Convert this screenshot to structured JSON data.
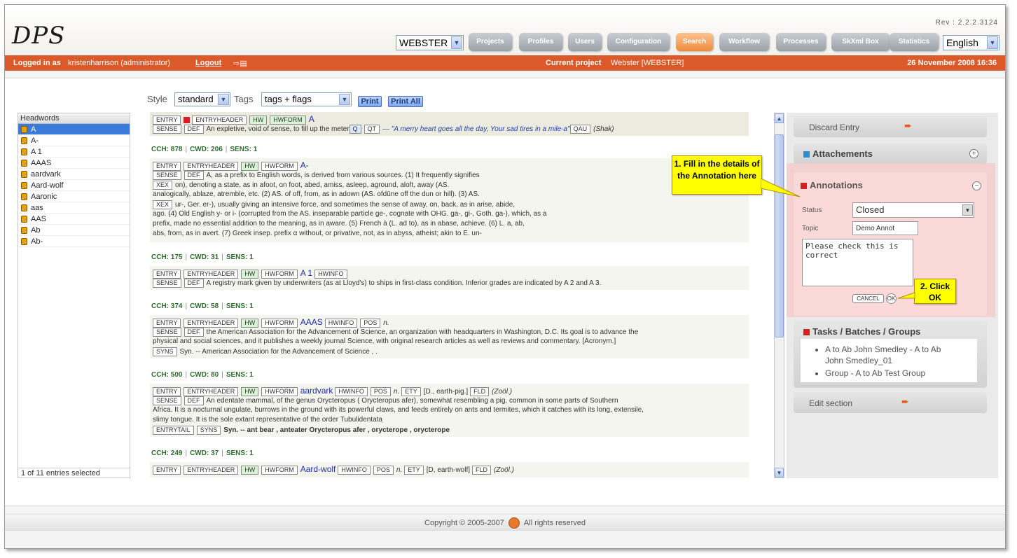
{
  "app": {
    "logo": "DPS",
    "revision": "Rev : 2.2.2.3124"
  },
  "header": {
    "dictionary_select": "WEBSTER",
    "language_select": "English",
    "nav": [
      "Projects",
      "Profiles",
      "Users",
      "Configuration",
      "Search",
      "Workflow",
      "Processes",
      "SkXml Box",
      "Statistics"
    ],
    "active_nav": "Search",
    "logged_in_label": "Logged in as",
    "user": "kristenharrison (administrator)",
    "logout": "Logout",
    "current_project_label": "Current project",
    "current_project": "Webster [WEBSTER]",
    "date": "26 November 2008 16:36"
  },
  "toolbar": {
    "style_label": "Style",
    "style_value": "standard",
    "tags_label": "Tags",
    "tags_value": "tags + flags",
    "print": "Print",
    "print_all": "Print All"
  },
  "headwords": {
    "title": "Headwords",
    "items": [
      "A",
      "A-",
      "A 1",
      "AAAS",
      "aardvark",
      "Aard-wolf",
      "Aaronic",
      "aas",
      "AAS",
      "Ab",
      "Ab-"
    ],
    "footer": "1 of 11 entries selected"
  },
  "entries": {
    "e0": {
      "head": "A",
      "def": "An expletive, void of sense, to fill up the meter",
      "quote": "— \"A merry heart goes all the day, Your sad tires in a mile-a\"",
      "source": "(Shak)"
    },
    "e1": {
      "cch": "CCH: 878",
      "cwd": "CWD: 206",
      "sens": "SENS: 1",
      "head": "A-",
      "l1": "A, as a prefix to English words, is derived from various sources. (1) It frequently signifies",
      "l2": "on), denoting a state, as in  afoot, on foot,  abed,  amiss,  asleep, aground,  aloft,  away (AS.",
      "l3": "analogically,  ablaze,  atremble, etc. (2) AS.  of off, from, as in  adown (AS.  ofdūne off the  dun or hill). (3) AS.",
      "l4": "ur-, Ger.  er-), usually giving an intensive force, and sometimes the sense of  away,  on,  back, as in  arise,  abide,",
      "l5": "ago. (4) Old English  y- or  i- (corrupted from the AS. inseparable particle  ge-, cognate with OHG.  ga-,  gi-, Goth.  ga-), which, as a",
      "l6": "prefix, made no essential addition to the meaning, as in aware. (5) French  à (L.  ad to), as in  abase,  achieve. (6) L.  a,  ab,",
      "l7": "abs, from, as in  avert. (7) Greek insep. prefix α without, or privative, not, as in  abyss,  atheist; akin to E.  un-"
    },
    "e2": {
      "cch": "CCH: 175",
      "cwd": "CWD: 31",
      "sens": "SENS: 1",
      "head": "A 1",
      "def": "A registry mark given by underwriters (as at Lloyd's) to ships in first-class condition. Inferior grades are indicated by A 2 and A 3."
    },
    "e3": {
      "cch": "CCH: 374",
      "cwd": "CWD: 58",
      "sens": "SENS: 1",
      "head": "AAAS",
      "pos": "n.",
      "l1": "the  American Association for the Advancement of Science, an organization with headquarters in Washington, D.C. Its goal is to advance the",
      "l2": "physical and social sciences, and it publishes a weekly journal  Science, with original research articles as well as reviews and commentary.  [Acronym.]",
      "l3": "Syn. --  American Association for the Advancement of Science  , ."
    },
    "e4": {
      "cch": "CCH: 500",
      "cwd": "CWD: 80",
      "sens": "SENS: 1",
      "head": "aardvark",
      "pos": "n.",
      "ety": "[D., earth-pig.]",
      "fld": "(Zoöl.)",
      "l1": "An edentate mammal, of the genus  Orycteropus (  Orycteropus afer), somewhat resembling a pig, common in some parts of Southern",
      "l2": "Africa. It is a nocturnal  ungulate, burrows in the ground with its powerful claws, and feeds entirely on ants and termites, which it catches with its long, extensile,",
      "l3": "slimy tongue. It is the sole extant representative of the order  Tubulidentata",
      "syn": "Syn. --  ant bear  , anteater  Orycteropus afer  , orycterope  , orycterope"
    },
    "e5": {
      "cch": "CCH: 249",
      "cwd": "CWD: 37",
      "sens": "SENS: 1",
      "head": "Aard-wolf",
      "pos": "n.",
      "ety": "[D, earth-wolf]",
      "fld": "(Zoöl.)"
    }
  },
  "right_panel": {
    "discard": "Discard Entry",
    "attachements": "Attachements",
    "annotations": "Annotations",
    "status_label": "Status",
    "status_value": "Closed",
    "topic_label": "Topic",
    "topic_value": "Demo Annot",
    "note": "Please check this is correct",
    "cancel": "CANCEL",
    "ok": "OK",
    "tasks_title": "Tasks / Batches / Groups",
    "tasks": [
      "A to Ab John Smedley - A to Ab John Smedley_01",
      "Group - A to Ab Test Group"
    ],
    "edit_section": "Edit section"
  },
  "callouts": {
    "one": "1. Fill in the details of the Annotation here",
    "two": "2. Click OK"
  },
  "footer": {
    "copyright": "Copyright © 2005-2007",
    "rights": "All rights reserved"
  },
  "colors": {
    "accent": "#dc5a2a",
    "active_tab": "#f08b3c",
    "callout": "#ffff00"
  }
}
